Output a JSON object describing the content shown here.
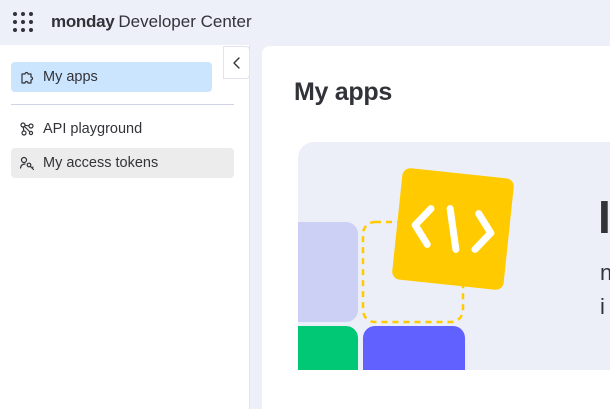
{
  "header": {
    "brand_bold": "monday",
    "brand_rest": "Developer Center"
  },
  "sidebar": {
    "items": [
      {
        "label": "My apps",
        "icon": "puzzle-icon",
        "state": "active"
      },
      {
        "label": "API playground",
        "icon": "api-nodes-icon",
        "state": "default"
      },
      {
        "label": "My access tokens",
        "icon": "key-user-icon",
        "state": "hover"
      }
    ]
  },
  "main": {
    "title": "My apps",
    "banner": {
      "code_icon": "code-icon",
      "heading": "I",
      "line1": "n",
      "line2": "i"
    }
  },
  "colors": {
    "topbar_bg": "#eef0f9",
    "active_item": "#cce5ff",
    "hover_item": "#ececec",
    "tile_lavender": "#cdd0f5",
    "tile_yellow": "#ffcb00",
    "tile_green": "#00c875",
    "tile_blue": "#6161ff",
    "dashed_border": "#ffcb00"
  }
}
